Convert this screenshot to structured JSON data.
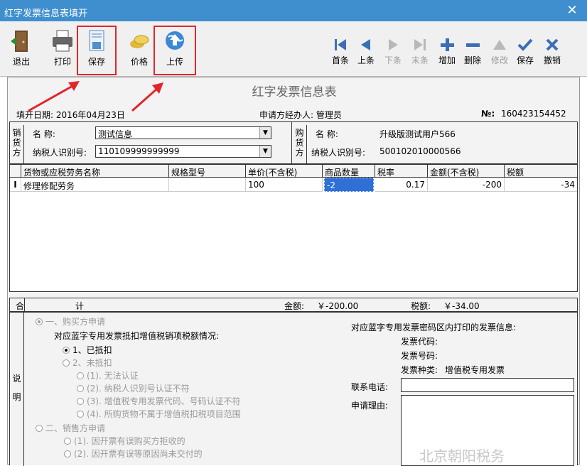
{
  "window": {
    "title": "红字发票信息表填开"
  },
  "toolbar": {
    "exit": "退出",
    "print": "打印",
    "save": "保存",
    "price": "价格",
    "upload": "上传",
    "first": "首条",
    "prev": "上条",
    "next": "下条",
    "last": "末条",
    "add": "增加",
    "delete": "删除",
    "modify": "修改",
    "save2": "保存",
    "cancel": "撤销"
  },
  "form": {
    "title": "红字发票信息表",
    "fill_date": "填开日期: 2016年04月23日",
    "applicant": "申请方经办人: 管理员",
    "no_label": "№:",
    "no_value": "160423154452"
  },
  "seller": {
    "label": "销货方",
    "name_label": "名      称:",
    "name_value": "测试信息",
    "taxid_label": "纳税人识别号:",
    "taxid_value": "110109999999999"
  },
  "buyer": {
    "label": "购货方",
    "name_label": "名      称:",
    "name_value": "升级版测试用户566",
    "taxid_label": "纳税人识别号:",
    "taxid_value": "500102010000566"
  },
  "table": {
    "headers": [
      "货物或应税劳务名称",
      "规格型号",
      "单价(不含税)",
      "商品数量",
      "税率",
      "金额(不含税)",
      "税额"
    ],
    "rows": [
      {
        "marker": "I",
        "name": "修理修配劳务",
        "spec": "",
        "price": "100",
        "qty": "-2",
        "rate": "0.17",
        "amount": "-200",
        "tax": "-34"
      }
    ]
  },
  "total": {
    "label1": "合",
    "label2": "计",
    "amount_label": "金额:",
    "amount_value": "￥-200.00",
    "tax_label": "税额:",
    "tax_value": "￥-34.00"
  },
  "note": {
    "label": "说明",
    "opt1": "一、购买方申请",
    "opt1_desc": "对应蓝字专用发票抵扣增值税销项税额情况:",
    "opt1_a": "1、已抵扣",
    "opt1_b": "2、未抵扣",
    "opt1_b1": "(1). 无法认证",
    "opt1_b2": "(2). 纳税人识别号认证不符",
    "opt1_b3": "(3). 增值税专用发票代码、号码认证不符",
    "opt1_b4": "(4). 所购货物不属于增值税扣税项目范围",
    "opt2": "二、销售方申请",
    "opt2_a": "(1). 因开票有误购买方拒收的",
    "opt2_b": "(2). 因开票有误等原因尚未交付的",
    "right_title": "对应蓝字专用发票密码区内打印的发票信息:",
    "code_label": "发票代码:",
    "number_label": "发票号码:",
    "kind_label": "发票种类:",
    "kind_value": "增值税专用发票",
    "phone_label": "联系电话:",
    "reason_label": "申请理由:"
  },
  "watermark": "北京朝阳税务"
}
